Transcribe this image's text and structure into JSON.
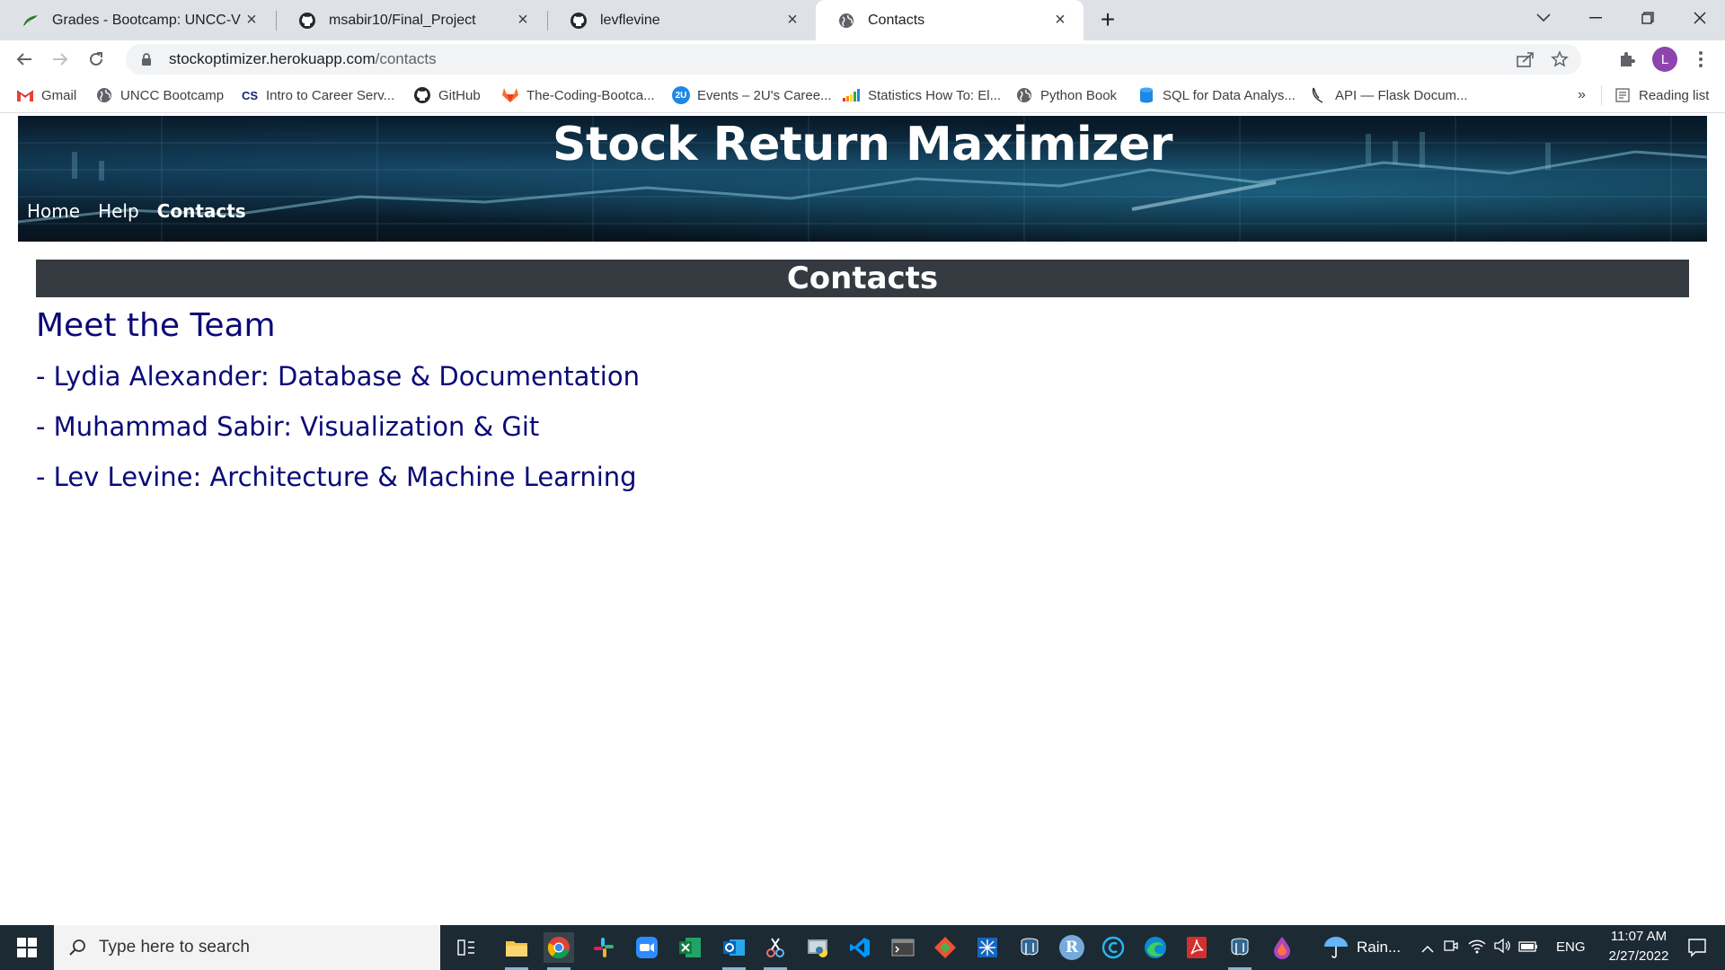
{
  "browser": {
    "tabs": [
      {
        "title": "Grades - Bootcamp: UNCC-VIRT-",
        "icon": "leaf-icon"
      },
      {
        "title": "msabir10/Final_Project",
        "icon": "github-icon"
      },
      {
        "title": "levflevine",
        "icon": "github-icon"
      },
      {
        "title": "Contacts",
        "icon": "globe-icon"
      }
    ],
    "url_host": "stockoptimizer.herokuapp.com",
    "url_path": "/contacts",
    "profile_initial": "L",
    "bookmarks": [
      {
        "label": "Gmail",
        "icon": "gmail-icon"
      },
      {
        "label": "UNCC Bootcamp",
        "icon": "globe-icon"
      },
      {
        "label": "Intro to Career Serv...",
        "icon": "cs-icon"
      },
      {
        "label": "GitHub",
        "icon": "github-icon"
      },
      {
        "label": "The-Coding-Bootca...",
        "icon": "gitlab-icon"
      },
      {
        "label": "Events – 2U's Caree...",
        "icon": "2u-icon"
      },
      {
        "label": "Statistics How To: El...",
        "icon": "bar-chart-icon"
      },
      {
        "label": "Python Book",
        "icon": "globe-icon"
      },
      {
        "label": "SQL for Data Analys...",
        "icon": "database-icon"
      },
      {
        "label": "API — Flask Docum...",
        "icon": "flask-icon"
      }
    ],
    "overflow_label": "»",
    "reading_list_label": "Reading list"
  },
  "page": {
    "site_title": "Stock Return Maximizer",
    "nav": [
      "Home",
      "Help",
      "Contacts"
    ],
    "section_title": "Contacts",
    "team_heading": "Meet the Team",
    "members": [
      "- Lydia Alexander: Database & Documentation",
      "- Muhammad Sabir: Visualization & Git",
      "- Lev Levine: Architecture & Machine Learning"
    ]
  },
  "taskbar": {
    "search_placeholder": "Type here to search",
    "weather": "Rain...",
    "language": "ENG",
    "time": "11:07 AM",
    "date": "2/27/2022",
    "r_icon_letter": "R"
  },
  "colors": {
    "tab_strip": "#dee1e6",
    "team_text": "#0a0a78",
    "contacts_bar": "#343a40",
    "taskbar": "#1c2a33",
    "profile": "#8e44ad"
  }
}
